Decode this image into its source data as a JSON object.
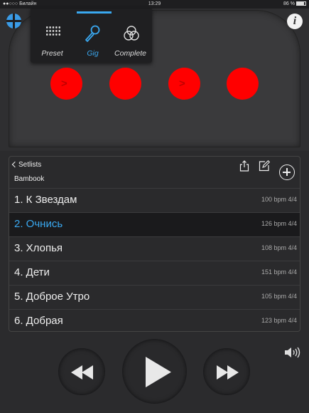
{
  "status_bar": {
    "carrier": "●●○○○ Билайн",
    "time": "13:29",
    "battery": "86 %"
  },
  "top_bar": {
    "globe_icon": "globe-icon",
    "info_label": "i"
  },
  "modes": [
    {
      "label": "Preset",
      "icon": "grid-icon",
      "selected": false
    },
    {
      "label": "Gig",
      "icon": "microphone-icon",
      "selected": true
    },
    {
      "label": "Complete",
      "icon": "venn-icon",
      "selected": false
    }
  ],
  "pads": [
    {
      "color": "#ff0000",
      "arrow": true
    },
    {
      "color": "#ff0000",
      "arrow": false
    },
    {
      "color": "#ff0000",
      "arrow": true
    },
    {
      "color": "#ff0000",
      "arrow": false
    }
  ],
  "setlist": {
    "back_label": "Setlists",
    "name": "Bambook",
    "actions": [
      "share-icon",
      "edit-icon",
      "add-icon"
    ],
    "songs": [
      {
        "title": "1. К Звездам",
        "meta": "100 bpm 4/4",
        "active": false
      },
      {
        "title": "2. Очнись",
        "meta": "126 bpm 4/4",
        "active": true
      },
      {
        "title": "3. Хлопья",
        "meta": "108 bpm 4/4",
        "active": false
      },
      {
        "title": "4. Дети",
        "meta": "151 bpm 4/4",
        "active": false
      },
      {
        "title": "5. Доброе Утро",
        "meta": "105 bpm 4/4",
        "active": false
      },
      {
        "title": "6. Добрая",
        "meta": "123 bpm 4/4",
        "active": false
      }
    ]
  },
  "transport": {
    "controls": [
      "rewind-icon",
      "play-icon",
      "fast-forward-icon"
    ],
    "volume_icon": "speaker-icon"
  },
  "colors": {
    "accent": "#3aa8f0",
    "pad": "#ff0000",
    "background": "#2b2b2d"
  }
}
